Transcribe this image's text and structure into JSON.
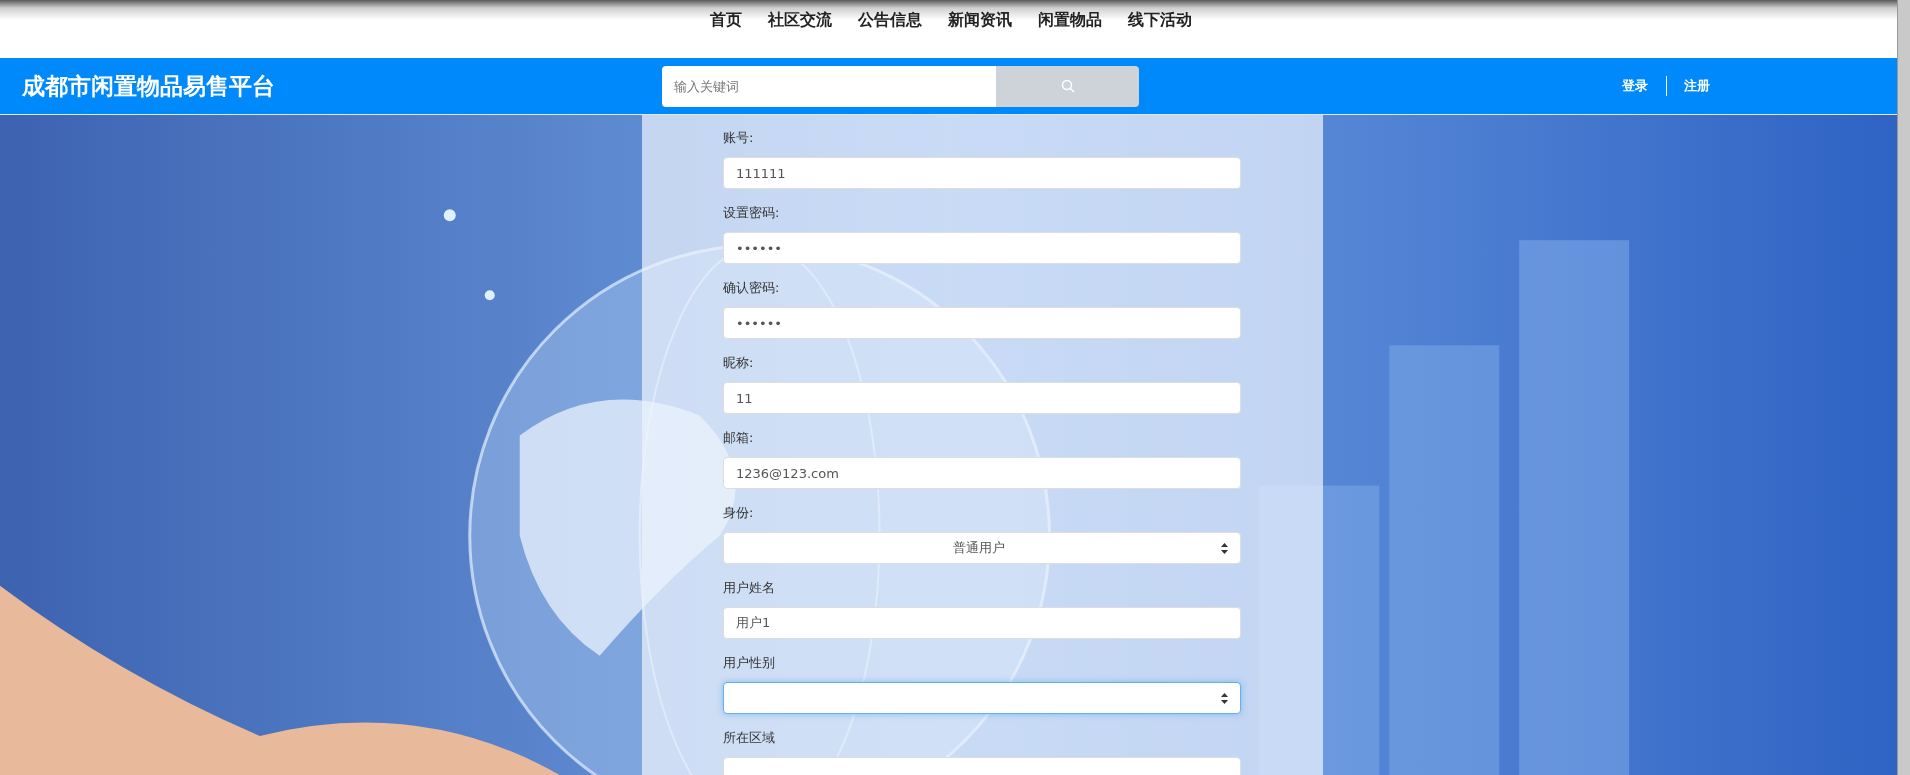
{
  "nav": [
    {
      "label": "首页"
    },
    {
      "label": "社区交流"
    },
    {
      "label": "公告信息"
    },
    {
      "label": "新闻资讯"
    },
    {
      "label": "闲置物品"
    },
    {
      "label": "线下活动"
    }
  ],
  "header": {
    "title": "成都市闲置物品易售平台",
    "search": {
      "placeholder": "输入关键词"
    },
    "links": [
      {
        "label": "登录"
      },
      {
        "label": "注册"
      }
    ]
  },
  "form": {
    "fields": [
      {
        "label": "账号:",
        "kind": "text",
        "value": "111111",
        "focused": false
      },
      {
        "label": "设置密码:",
        "kind": "password",
        "value": "••••••",
        "focused": false
      },
      {
        "label": "确认密码:",
        "kind": "password",
        "value": "••••••",
        "focused": false
      },
      {
        "label": "昵称:",
        "kind": "text",
        "value": "11",
        "focused": false
      },
      {
        "label": "邮箱:",
        "kind": "text",
        "value": "1236@123.com",
        "focused": false
      },
      {
        "label": "身份:",
        "kind": "select",
        "value": "普通用户",
        "focused": false
      },
      {
        "label": "用户姓名",
        "kind": "text",
        "value": "用户1",
        "focused": false
      },
      {
        "label": "用户性别",
        "kind": "select",
        "focused": true
      },
      {
        "label": "所在区域",
        "kind": "text",
        "focused": false
      }
    ]
  }
}
